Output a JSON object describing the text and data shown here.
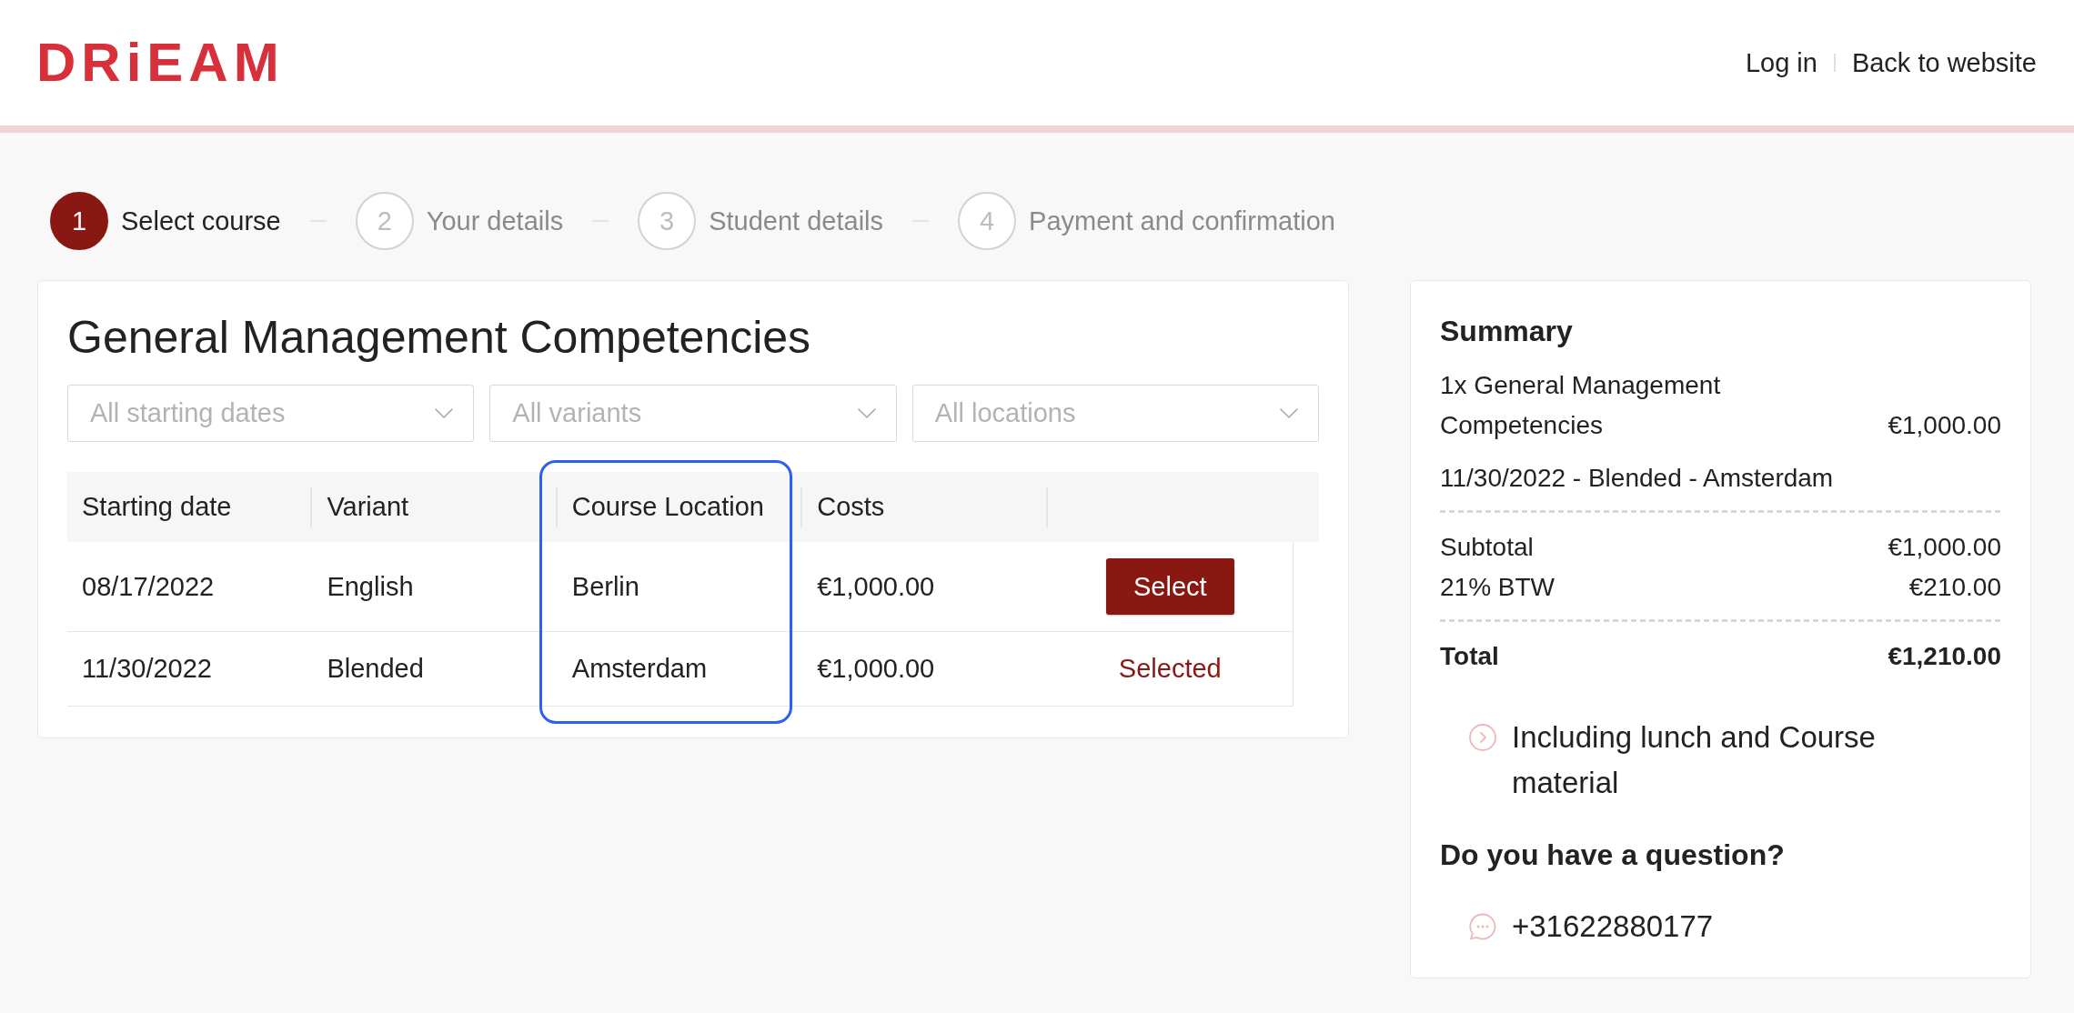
{
  "header": {
    "logo": "DRiEAM",
    "links": [
      {
        "label": "Log in"
      },
      {
        "label": "Back to website"
      }
    ]
  },
  "steps": [
    {
      "number": "1",
      "label": "Select course",
      "active": true
    },
    {
      "number": "2",
      "label": "Your details",
      "active": false
    },
    {
      "number": "3",
      "label": "Student details",
      "active": false
    },
    {
      "number": "4",
      "label": "Payment and confirmation",
      "active": false
    }
  ],
  "course": {
    "title": "General Management Competencies",
    "filters": [
      {
        "placeholder": "All starting dates"
      },
      {
        "placeholder": "All variants"
      },
      {
        "placeholder": "All locations"
      }
    ],
    "table": {
      "columns": [
        {
          "label": "Starting date",
          "highlighted": false
        },
        {
          "label": "Variant",
          "highlighted": false
        },
        {
          "label": "Course Location",
          "highlighted": true
        },
        {
          "label": "Costs",
          "highlighted": false
        }
      ],
      "rows": [
        {
          "starting_date": "08/17/2022",
          "variant": "English",
          "course_location": "Berlin",
          "costs": "€1,000.00",
          "selected": false,
          "action": "Select"
        },
        {
          "starting_date": "11/30/2022",
          "variant": "Blended",
          "course_location": "Amsterdam",
          "costs": "€1,000.00",
          "selected": true,
          "action": "Selected"
        }
      ]
    }
  },
  "summary": {
    "title": "Summary",
    "item": {
      "name": "1x General Management Competencies",
      "price": "€1,000.00",
      "details": "11/30/2022 - Blended - Amsterdam"
    },
    "lines": [
      {
        "label": "Subtotal",
        "amount": "€1,000.00"
      },
      {
        "label": "21% BTW",
        "amount": "€210.00"
      }
    ],
    "total": {
      "label": "Total",
      "amount": "€1,210.00"
    },
    "features": [
      "Including lunch and Course material"
    ],
    "question": {
      "title": "Do you have a question?",
      "phone": "+31622880177"
    }
  }
}
